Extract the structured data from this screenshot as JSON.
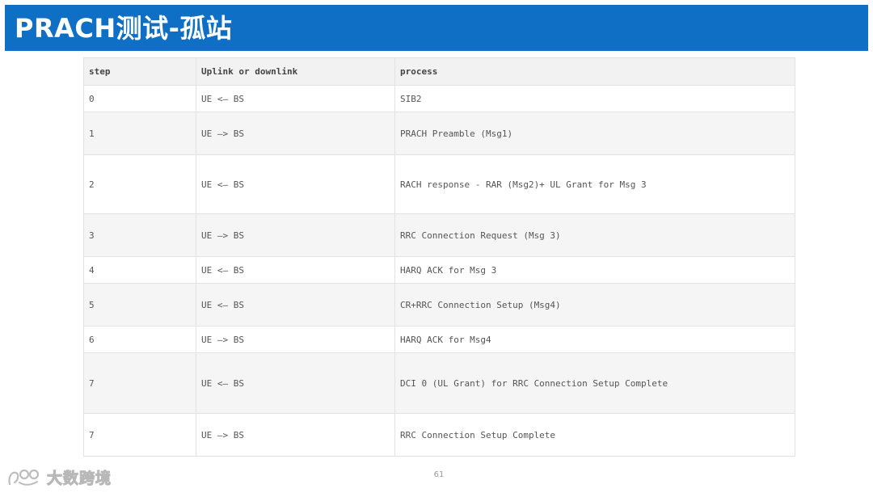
{
  "slide": {
    "title": "PRACH测试-孤站",
    "page_number": "61",
    "watermark": "大数跨境"
  },
  "table": {
    "headers": [
      "step",
      "Uplink or downlink",
      "process"
    ],
    "rows": [
      {
        "step": "0",
        "direction": "UE <— BS",
        "process": "SIB2"
      },
      {
        "step": "1",
        "direction": "UE —> BS",
        "process": "PRACH Preamble (Msg1)"
      },
      {
        "step": "2",
        "direction": "UE <— BS",
        "process": "RACH response - RAR (Msg2)+ UL Grant for Msg 3"
      },
      {
        "step": "3",
        "direction": "UE —> BS",
        "process": "RRC Connection Request (Msg 3)"
      },
      {
        "step": "4",
        "direction": "UE <— BS",
        "process": "HARQ ACK for Msg 3"
      },
      {
        "step": "5",
        "direction": "UE <— BS",
        "process": "CR+RRC Connection Setup (Msg4)"
      },
      {
        "step": "6",
        "direction": "UE —> BS",
        "process": "HARQ ACK for Msg4"
      },
      {
        "step": "7",
        "direction": "UE <— BS",
        "process": "DCI 0 (UL Grant) for RRC Connection Setup Complete"
      },
      {
        "step": "7",
        "direction": "UE —> BS",
        "process": "RRC Connection Setup Complete"
      }
    ]
  },
  "colors": {
    "title_bar": "#0f6fc4",
    "header_bg": "#f2f2f2",
    "shaded_row": "#f5f5f5"
  }
}
